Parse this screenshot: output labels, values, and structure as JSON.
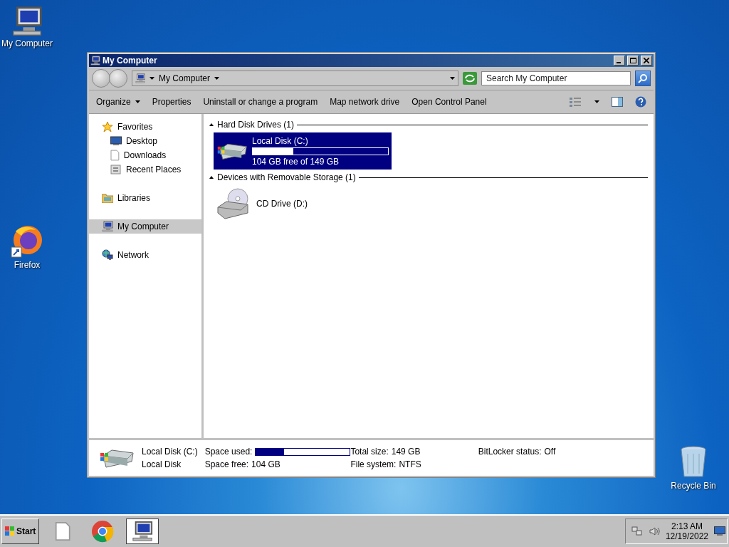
{
  "desktop_icons": [
    {
      "label": "My Computer",
      "kind": "computer"
    },
    {
      "label": "Firefox",
      "kind": "firefox"
    },
    {
      "label": "Recycle Bin",
      "kind": "recycle"
    }
  ],
  "window": {
    "title": "My Computer",
    "address": {
      "path": "My Computer"
    },
    "search": {
      "placeholder": "Search My Computer"
    },
    "commands": [
      {
        "label": "Organize",
        "dropdown": true
      },
      {
        "label": "Properties",
        "dropdown": false
      },
      {
        "label": "Uninstall or change a program",
        "dropdown": false
      },
      {
        "label": "Map network drive",
        "dropdown": false
      },
      {
        "label": "Open Control Panel",
        "dropdown": false
      }
    ],
    "nav": [
      {
        "label": "Favorites",
        "kind": "star",
        "selected": false,
        "children": [
          {
            "label": "Desktop",
            "kind": "desktop",
            "selected": false
          },
          {
            "label": "Downloads",
            "kind": "file",
            "selected": false
          },
          {
            "label": "Recent Places",
            "kind": "recent",
            "selected": false
          }
        ]
      },
      {
        "label": "Libraries",
        "kind": "library",
        "selected": false
      },
      {
        "label": "My Computer",
        "kind": "computer",
        "selected": true
      },
      {
        "label": "Network",
        "kind": "network",
        "selected": false
      }
    ],
    "groups": [
      {
        "title": "Hard Disk Drives (1)",
        "expanded": true,
        "items": [
          {
            "name": "Local Disk (C:)",
            "kind": "disk",
            "selected": true,
            "level": 0.3,
            "caption": "104 GB free of 149 GB"
          }
        ]
      },
      {
        "title": "Devices with Removable Storage (1)",
        "expanded": true,
        "items": [
          {
            "name": "CD Drive (D:)",
            "kind": "cd",
            "selected": false
          }
        ]
      }
    ],
    "details": {
      "name": "Local Disk (C:)",
      "type": "Local Disk",
      "fields": [
        {
          "label": "Space used:",
          "level": 0.3
        },
        {
          "label": "Space free:",
          "value": "104 GB"
        },
        {
          "label": "Total size:",
          "value": "149 GB"
        },
        {
          "label": "File system:",
          "value": "NTFS"
        },
        {
          "label": "BitLocker status:",
          "value": "Off"
        }
      ]
    }
  },
  "taskbar": {
    "start": "Start",
    "apps": [
      {
        "kind": "file",
        "active": false
      },
      {
        "kind": "chrome",
        "active": false
      },
      {
        "kind": "computer",
        "active": true
      }
    ],
    "time": "2:13 AM",
    "date": "12/19/2022"
  }
}
